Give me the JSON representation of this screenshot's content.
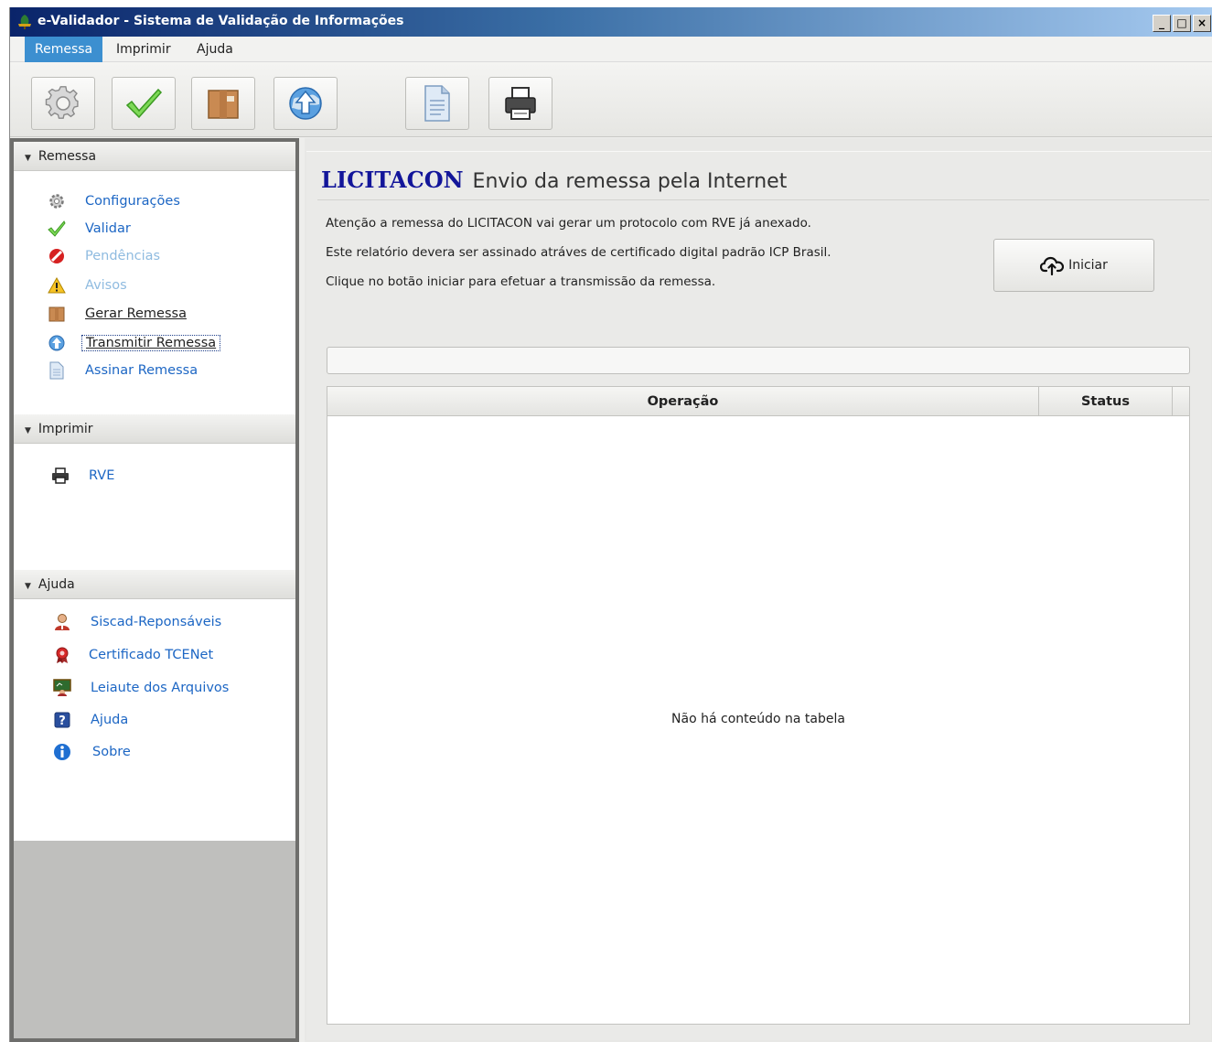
{
  "window": {
    "title": "e-Validador - Sistema de Validação de Informações",
    "controls": {
      "minimize": "_",
      "maximize": "□",
      "close": "×"
    }
  },
  "menu": {
    "items": [
      {
        "label": "Remessa",
        "active": true
      },
      {
        "label": "Imprimir",
        "active": false
      },
      {
        "label": "Ajuda",
        "active": false
      }
    ]
  },
  "toolbar": {
    "buttons": [
      {
        "icon": "gear-icon"
      },
      {
        "icon": "check-icon"
      },
      {
        "icon": "package-icon"
      },
      {
        "icon": "globe-upload-icon"
      },
      {
        "icon": "document-icon"
      },
      {
        "icon": "printer-icon"
      }
    ]
  },
  "sidebar": {
    "remessa": {
      "header": "Remessa",
      "items": [
        {
          "label": "Configurações",
          "icon": "gear-icon",
          "state": "enabled"
        },
        {
          "label": "Validar",
          "icon": "check-icon",
          "state": "enabled"
        },
        {
          "label": "Pendências",
          "icon": "no-entry-icon",
          "state": "disabled"
        },
        {
          "label": "Avisos",
          "icon": "warning-icon",
          "state": "disabled"
        },
        {
          "label": "Gerar Remessa",
          "icon": "package-icon",
          "state": "visited"
        },
        {
          "label": "Transmitir Remessa",
          "icon": "globe-upload-icon",
          "state": "selected"
        },
        {
          "label": "Assinar Remessa",
          "icon": "document-icon",
          "state": "enabled"
        }
      ]
    },
    "imprimir": {
      "header": "Imprimir",
      "items": [
        {
          "label": "RVE",
          "icon": "printer-icon",
          "state": "enabled"
        }
      ]
    },
    "ajuda": {
      "header": "Ajuda",
      "items": [
        {
          "label": "Siscad-Reponsáveis",
          "icon": "person-icon",
          "state": "enabled"
        },
        {
          "label": "Certificado TCENet",
          "icon": "ribbon-icon",
          "state": "enabled"
        },
        {
          "label": "Leiaute dos Arquivos",
          "icon": "board-icon",
          "state": "enabled"
        },
        {
          "label": "Ajuda",
          "icon": "help-icon",
          "state": "enabled"
        },
        {
          "label": "Sobre",
          "icon": "info-icon",
          "state": "enabled"
        }
      ]
    }
  },
  "main": {
    "heading_strong": "LICITACON",
    "heading_sub": "Envio da remessa pela Internet",
    "messages": [
      "Atenção a remessa do LICITACON vai gerar um protocolo com RVE já anexado.",
      "Este relatório devera ser assinado atráves de certificado digital padrão ICP Brasil.",
      "Clique no botão iniciar para efetuar a transmissão da remessa."
    ],
    "start_button": "Iniciar",
    "progress": 0,
    "table": {
      "columns": [
        "Operação",
        "Status"
      ],
      "rows": [],
      "empty_text": "Não há conteúdo na tabela"
    }
  },
  "colors": {
    "accent": "#3c8fd0",
    "link": "#1c66c4",
    "link_disabled": "#8fbbe0",
    "heading": "#13169a"
  }
}
